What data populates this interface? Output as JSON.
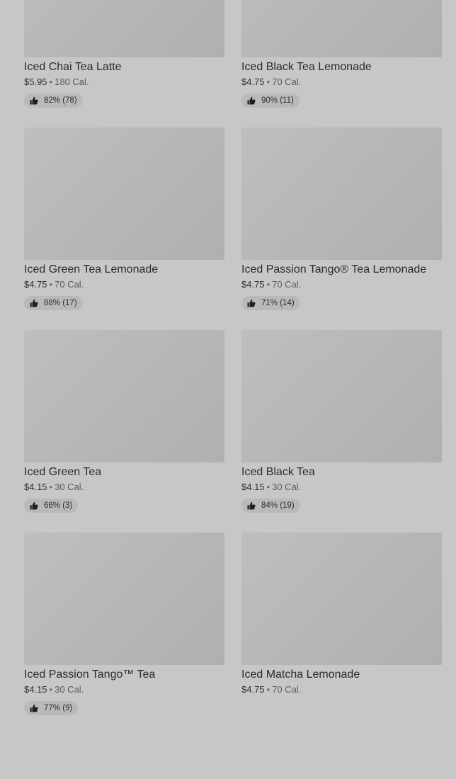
{
  "items": [
    {
      "name": "Iced Chai Tea Latte",
      "price": "$5.95",
      "separator": "•",
      "calories": "180 Cal.",
      "rating": "82% (78)"
    },
    {
      "name": "Iced Black Tea Lemonade",
      "price": "$4.75",
      "separator": "•",
      "calories": "70 Cal.",
      "rating": "90% (11)"
    },
    {
      "name": "Iced Green Tea Lemonade",
      "price": "$4.75",
      "separator": "•",
      "calories": "70 Cal.",
      "rating": "88% (17)"
    },
    {
      "name": "Iced Passion Tango® Tea Lemonade",
      "price": "$4.75",
      "separator": "•",
      "calories": "70 Cal.",
      "rating": "71% (14)"
    },
    {
      "name": "Iced Green Tea",
      "price": "$4.15",
      "separator": "•",
      "calories": "30 Cal.",
      "rating": "66% (3)"
    },
    {
      "name": "Iced Black Tea",
      "price": "$4.15",
      "separator": "•",
      "calories": "30 Cal.",
      "rating": "84% (19)"
    },
    {
      "name": "Iced Passion Tango™ Tea",
      "price": "$4.15",
      "separator": "•",
      "calories": "30 Cal.",
      "rating": "77% (9)"
    },
    {
      "name": "Iced Matcha Lemonade",
      "price": "$4.75",
      "separator": "•",
      "calories": "70 Cal.",
      "rating": ""
    }
  ],
  "icons": {
    "rating": "thumbs-up-icon"
  }
}
